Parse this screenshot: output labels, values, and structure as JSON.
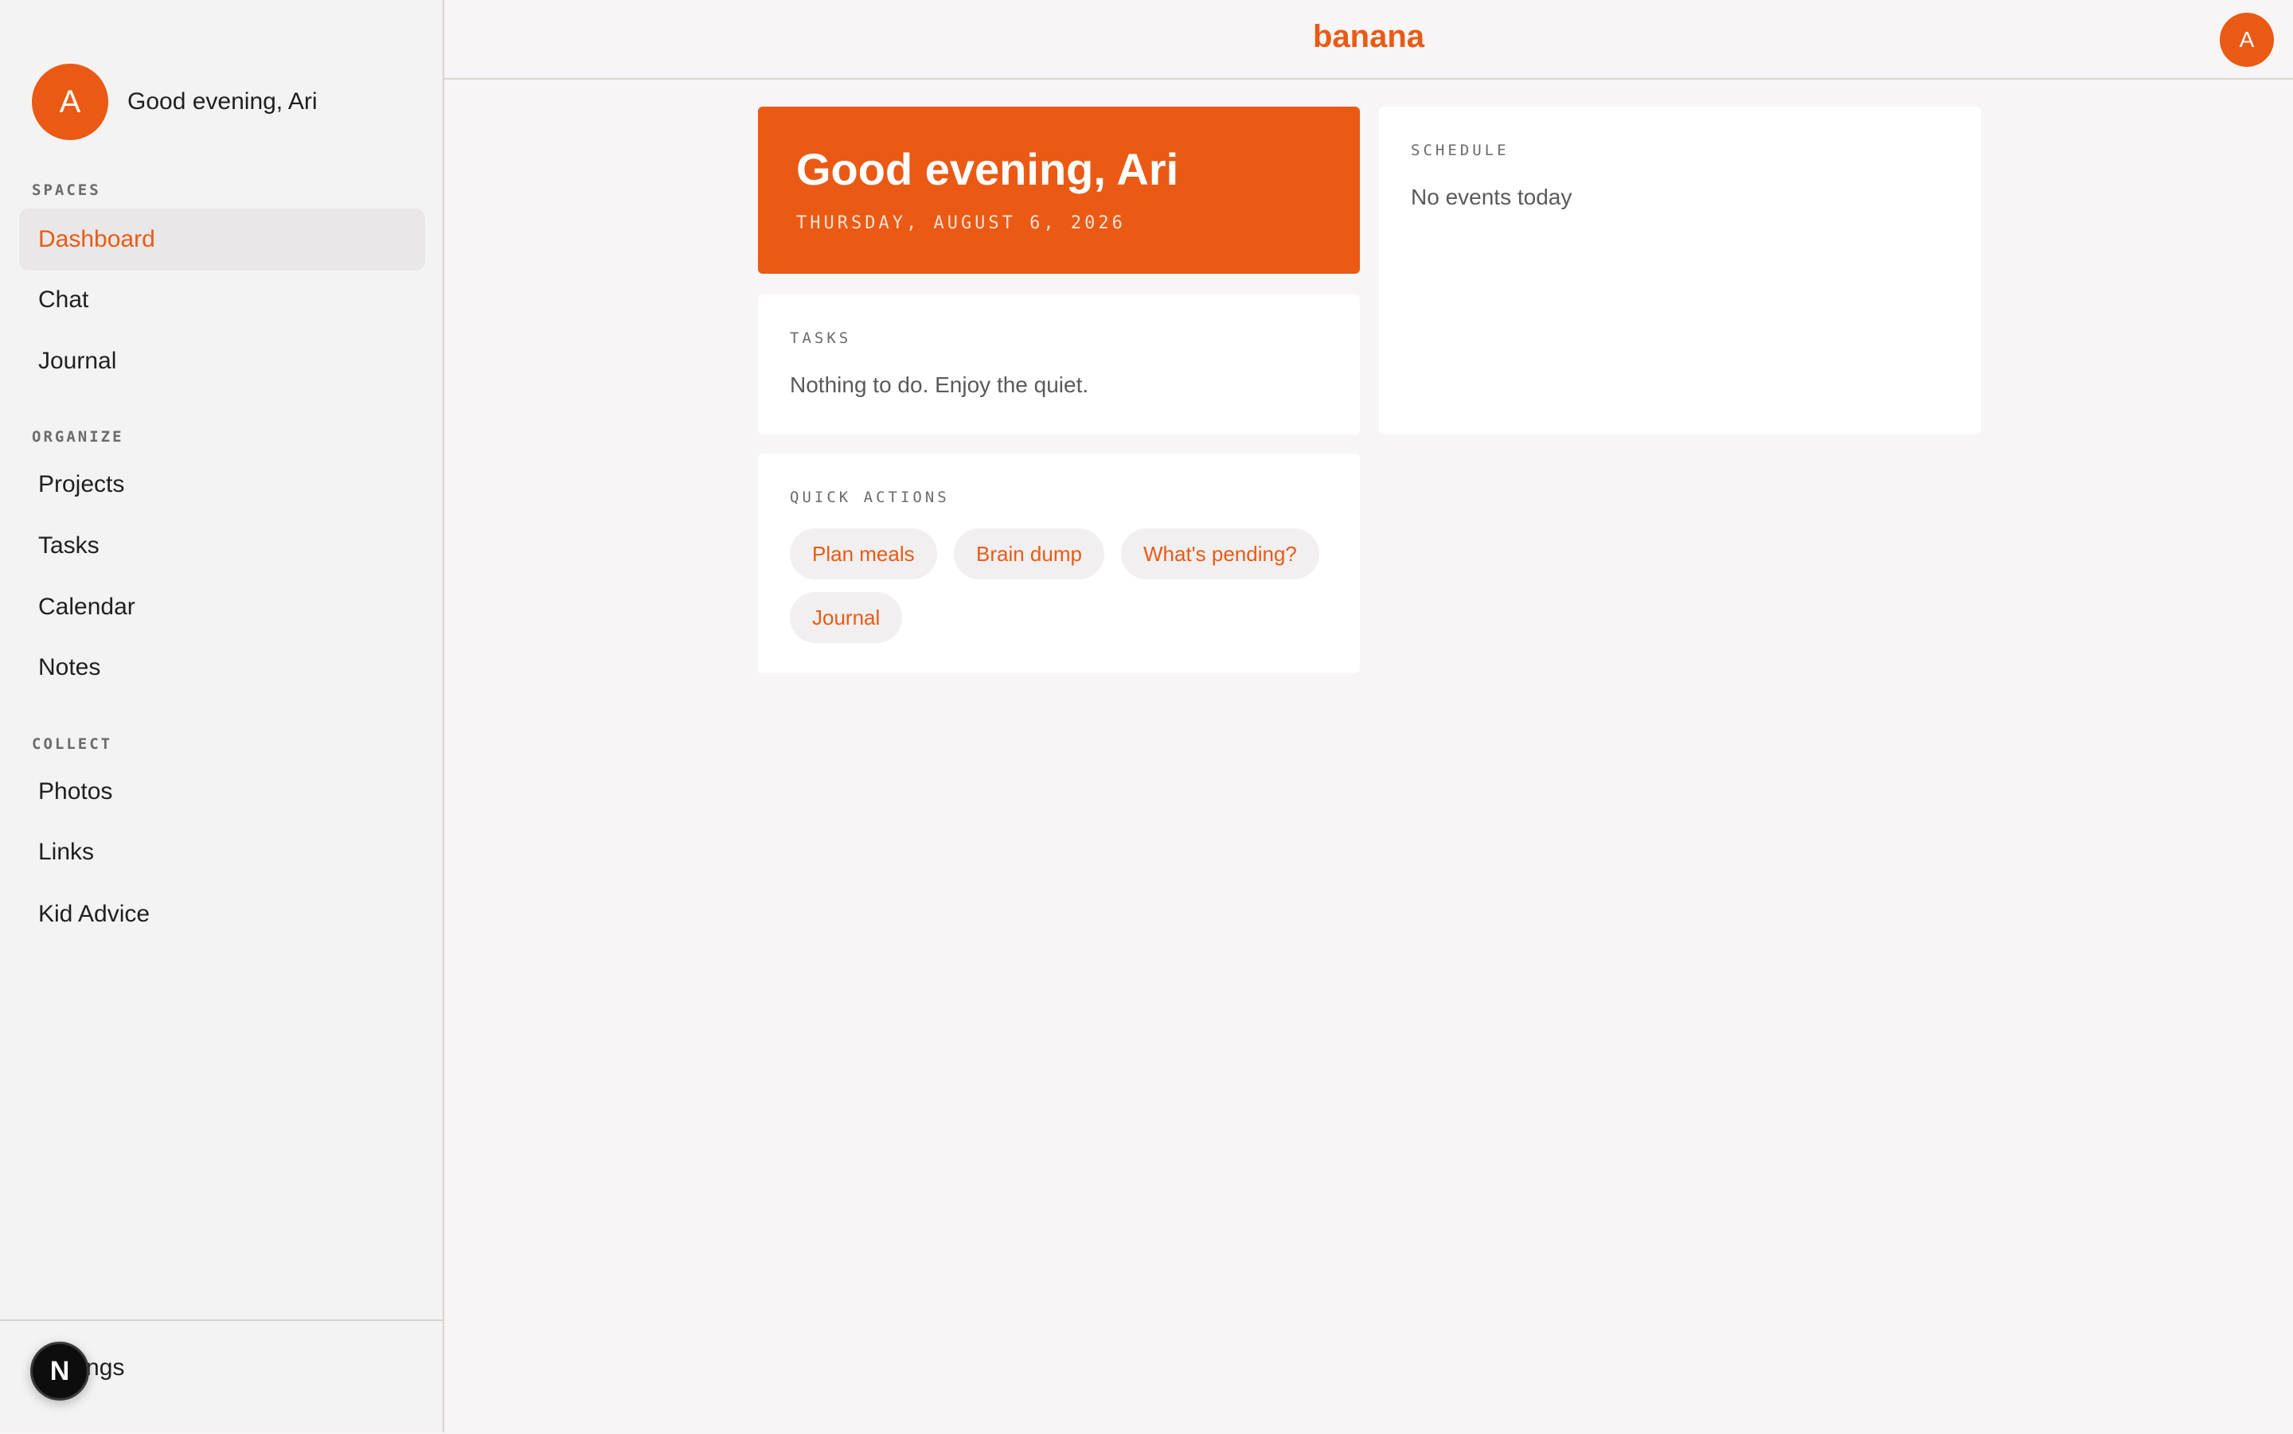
{
  "sidebar": {
    "avatar_initial": "A",
    "greeting": "Good evening, Ari",
    "sections": [
      {
        "label": "SPACES",
        "items": [
          {
            "label": "Dashboard"
          },
          {
            "label": "Chat"
          },
          {
            "label": "Journal"
          }
        ]
      },
      {
        "label": "ORGANIZE",
        "items": [
          {
            "label": "Projects"
          },
          {
            "label": "Tasks"
          },
          {
            "label": "Calendar"
          },
          {
            "label": "Notes"
          }
        ]
      },
      {
        "label": "COLLECT",
        "items": [
          {
            "label": "Photos"
          },
          {
            "label": "Links"
          },
          {
            "label": "Kid Advice"
          }
        ]
      }
    ],
    "active_item": "Dashboard",
    "footer": {
      "settings_label": "Settings",
      "badge_letter": "N"
    }
  },
  "header": {
    "brand": "banana",
    "avatar_initial": "A"
  },
  "main": {
    "hero": {
      "title": "Good evening, Ari",
      "date": "THURSDAY, AUGUST 6, 2026"
    },
    "tasks": {
      "label": "TASKS",
      "empty_text": "Nothing to do. Enjoy the quiet."
    },
    "schedule": {
      "label": "SCHEDULE",
      "empty_text": "No events today"
    },
    "quick_actions": {
      "label": "QUICK ACTIONS",
      "actions": [
        "Plan meals",
        "Brain dump",
        "What's pending?",
        "Journal"
      ]
    }
  },
  "colors": {
    "accent": "#ea5a15",
    "background": "#f7f5f5",
    "card": "#ffffff",
    "sidebar": "#f4f3f3"
  },
  "icons": {
    "dev_badge": "nextjs-icon"
  }
}
